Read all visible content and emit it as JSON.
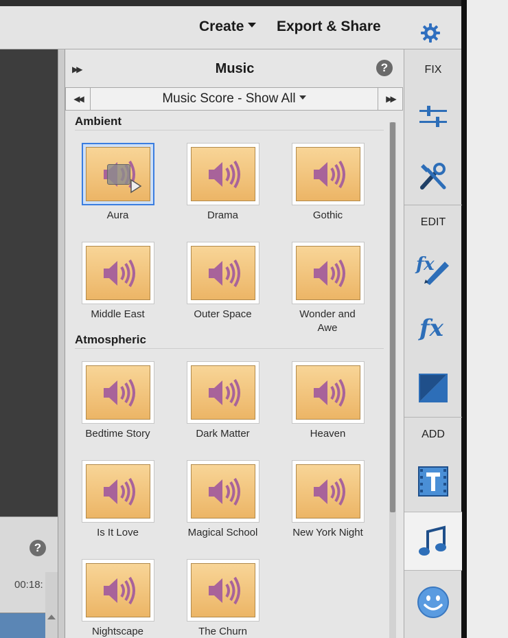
{
  "topbar": {
    "create_label": "Create",
    "export_label": "Export & Share",
    "settings_icon": "gear-icon"
  },
  "panel": {
    "title": "Music",
    "help": "?",
    "category_label": "Music Score - Show All",
    "sections": [
      {
        "title": "Ambient",
        "items": [
          "Aura",
          "Drama",
          "Gothic",
          "Middle East",
          "Outer Space",
          "Wonder and Awe"
        ]
      },
      {
        "title": "Atmospheric",
        "items": [
          "Bedtime Story",
          "Dark Matter",
          "Heaven",
          "Is It Love",
          "Magical School",
          "New York Night",
          "Nightscape",
          "The Churn"
        ]
      }
    ],
    "selected_item": "Aura"
  },
  "timeline": {
    "time_readout": "00:18:",
    "help": "?"
  },
  "toolbar": {
    "fix_label": "FIX",
    "edit_label": "EDIT",
    "add_label": "ADD",
    "tools": [
      {
        "group": "FIX",
        "icon": "adjust-sliders-icon"
      },
      {
        "group": "FIX",
        "icon": "tools-icon"
      },
      {
        "group": "EDIT",
        "icon": "fx-edit-icon"
      },
      {
        "group": "EDIT",
        "icon": "fx-icon"
      },
      {
        "group": "EDIT",
        "icon": "transitions-icon"
      },
      {
        "group": "ADD",
        "icon": "title-text-icon"
      },
      {
        "group": "ADD",
        "icon": "music-note-icon"
      },
      {
        "group": "ADD",
        "icon": "graphics-smiley-icon"
      }
    ],
    "active_tool": "music-note-icon"
  },
  "colors": {
    "accent_blue": "#3a7de0",
    "thumb_orange": "#ecb566",
    "speaker_purple": "#a8639a"
  }
}
